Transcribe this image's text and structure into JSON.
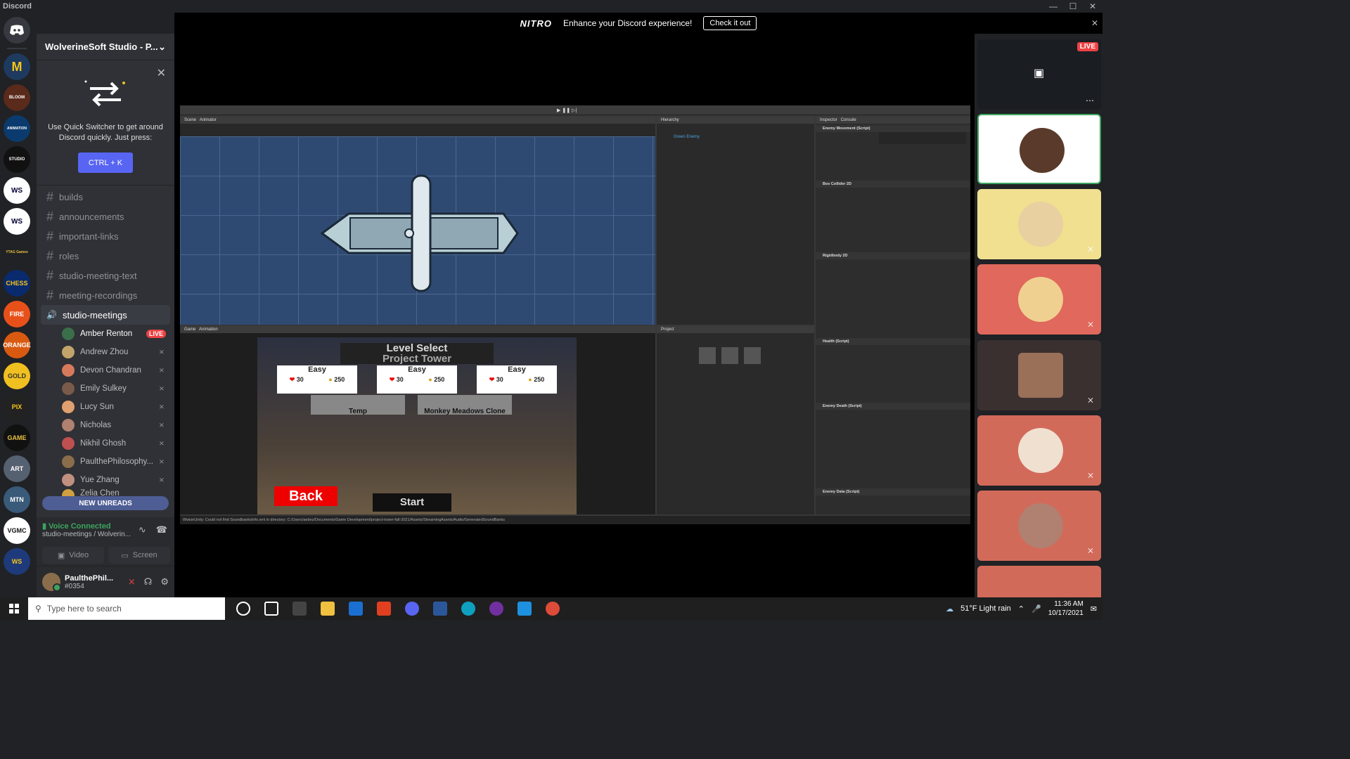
{
  "window": {
    "title": "Discord"
  },
  "nitro_banner": {
    "logo": "NITRO",
    "message": "Enhance your Discord experience!",
    "cta": "Check it out"
  },
  "server": {
    "name": "WolverineSoft Studio - P..."
  },
  "rail": {
    "servers": [
      "M",
      "BLOOM",
      "ANIMATION",
      "STUDIO",
      "WS",
      "WS",
      "YTAG Games",
      "CHESS",
      "FIRE",
      "ORANGE",
      "GOLD",
      "PIX",
      "GAME",
      "ART",
      "MTN",
      "VGMC",
      "WS"
    ]
  },
  "quick_switcher": {
    "text": "Use Quick Switcher to get around Discord quickly. Just press:",
    "shortcut": "CTRL + K"
  },
  "channels": [
    {
      "name": "builds"
    },
    {
      "name": "announcements"
    },
    {
      "name": "important-links"
    },
    {
      "name": "roles"
    },
    {
      "name": "studio-meeting-text"
    },
    {
      "name": "meeting-recordings"
    }
  ],
  "voice_channel": {
    "name": "studio-meetings"
  },
  "members": [
    {
      "name": "Amber Renton",
      "live": "LIVE",
      "color": "#3b6e4a"
    },
    {
      "name": "Andrew Zhou",
      "color": "#c2a46b"
    },
    {
      "name": "Devon Chandran",
      "color": "#d77a5c"
    },
    {
      "name": "Emily Sulkey",
      "color": "#7a5a48"
    },
    {
      "name": "Lucy Sun",
      "color": "#e0a070"
    },
    {
      "name": "Nicholas",
      "color": "#b08070"
    },
    {
      "name": "Nikhil Ghosh",
      "color": "#c05050"
    },
    {
      "name": "PaulthePhilosophy...",
      "color": "#8a6d4a"
    },
    {
      "name": "Yue Zhang",
      "color": "#c09080"
    },
    {
      "name": "Zelia Chen",
      "color": "#d0a040"
    }
  ],
  "new_unreads": "NEW UNREADS",
  "voice_status": {
    "status": "Voice Connected",
    "channel": "studio-meetings / Wolverin...",
    "video_label": "Video",
    "screen_label": "Screen"
  },
  "user": {
    "name": "PaulthePhil...",
    "tag": "#0354"
  },
  "stream": {
    "level_select": "Level Select",
    "project_title": "Project Tower",
    "cards": [
      {
        "difficulty": "Easy",
        "health": "30",
        "gold": "250"
      },
      {
        "difficulty": "Easy",
        "health": "30",
        "gold": "250"
      },
      {
        "difficulty": "Easy",
        "health": "30",
        "gold": "250"
      }
    ],
    "levels": [
      "Temp",
      "Monkey Meadows Clone"
    ],
    "back": "Back",
    "start": "Start",
    "scene_tab": "Scene",
    "animator_tab": "Animator",
    "game_tab": "Game",
    "animation_tab": "Animation",
    "hierarchy_tab": "Hierarchy",
    "project_tab": "Project",
    "inspector_tab": "Inspector",
    "console_tab": "Console",
    "hierarchy_item": "Green Enemy",
    "inspector_components": [
      "Enemy Movement (Script)",
      "Box Collider 2D",
      "Rigidbody 2D",
      "Health (Script)",
      "Enemy Death (Script)",
      "Enemy Data (Script)"
    ],
    "status_line": "WwiseUnity: Could not find SoundbanksInfo.xml in directory: C:/Users/aebez/Documents/Game Development/project-tower-fall-2021/Assets/StreamingAssets/Audio/GeneratedSoundBanks",
    "live_badge": "LIVE"
  },
  "taskbar": {
    "search_placeholder": "Type here to search",
    "weather": "51°F  Light rain",
    "time": "11:36 AM",
    "date": "10/17/2021"
  }
}
